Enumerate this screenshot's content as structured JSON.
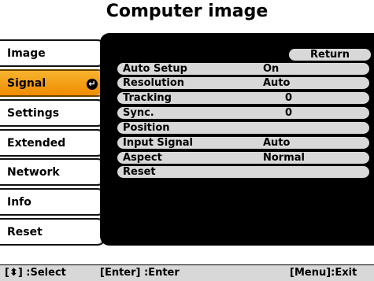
{
  "title": "Computer image",
  "menu": [
    {
      "label": "Image"
    },
    {
      "label": "Signal",
      "selected": true
    },
    {
      "label": "Settings"
    },
    {
      "label": "Extended"
    },
    {
      "label": "Network"
    },
    {
      "label": "Info"
    },
    {
      "label": "Reset"
    }
  ],
  "return_label": "Return",
  "rows": [
    {
      "label": "Auto Setup",
      "value": "On"
    },
    {
      "label": "Resolution",
      "value": "Auto"
    },
    {
      "label": "Tracking",
      "value": "0"
    },
    {
      "label": "Sync.",
      "value": "0"
    },
    {
      "label": "Position",
      "value": ""
    },
    {
      "label": "Input Signal",
      "value": "Auto"
    },
    {
      "label": "Aspect",
      "value": "Normal"
    },
    {
      "label": "Reset",
      "value": ""
    }
  ],
  "footer": {
    "select": "[⬍] :Select",
    "enter": "[Enter] :Enter",
    "menu_exit": "[Menu]:Exit"
  },
  "colors": {
    "selected": "#f5a623",
    "panel": "#000000",
    "row": "#d8d8d8"
  }
}
